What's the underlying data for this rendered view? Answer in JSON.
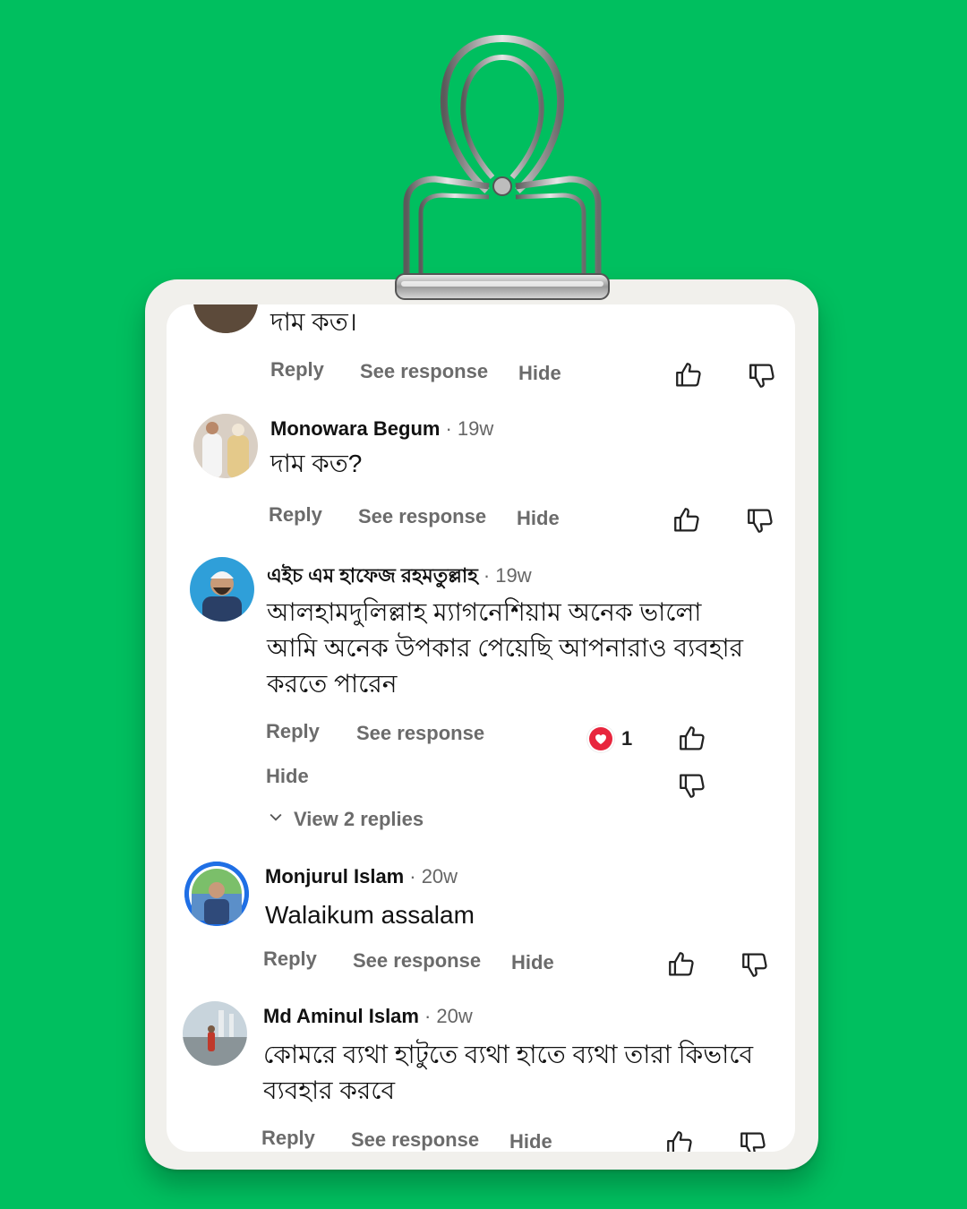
{
  "comments": [
    {
      "text": "দাম কত।",
      "actions": {
        "reply": "Reply",
        "see_response": "See response",
        "hide": "Hide"
      }
    },
    {
      "author": "Monowara Begum",
      "time": "· 19w",
      "text": "দাম কত?",
      "actions": {
        "reply": "Reply",
        "see_response": "See response",
        "hide": "Hide"
      }
    },
    {
      "author": "এইচ এম হাফেজ রহমতুল্লাহ",
      "time": "· 19w",
      "text_lines": [
        "আলহামদুলিল্লাহ ম্যাগনেশিয়াম অনেক ভালো",
        "আমি অনেক উপকার পেয়েছি আপনারাও ব্যবহার",
        "করতে পারেন"
      ],
      "actions": {
        "reply": "Reply",
        "see_response": "See response",
        "hide": "Hide"
      },
      "reaction_count": "1",
      "view_replies": "View 2 replies"
    },
    {
      "author": "Monjurul Islam",
      "time": "· 20w",
      "text": "Walaikum assalam",
      "actions": {
        "reply": "Reply",
        "see_response": "See response",
        "hide": "Hide"
      }
    },
    {
      "author": "Md Aminul Islam",
      "time": "· 20w",
      "text_lines": [
        "কোমরে ব্যথা হাটুতে ব্যথা হাতে ব্যথা তারা কিভাবে",
        "ব্যবহার করবে"
      ],
      "actions": {
        "reply": "Reply",
        "see_response": "See response",
        "hide": "Hide"
      }
    }
  ],
  "colors": {
    "background": "#00bf5f",
    "board": "#f1f0ec",
    "card": "#ffffff",
    "heart": "#e8253d"
  },
  "icons": [
    "thumbs-up-icon",
    "thumbs-down-icon",
    "heart-icon",
    "chevron-down-icon",
    "binder-clip-icon"
  ]
}
